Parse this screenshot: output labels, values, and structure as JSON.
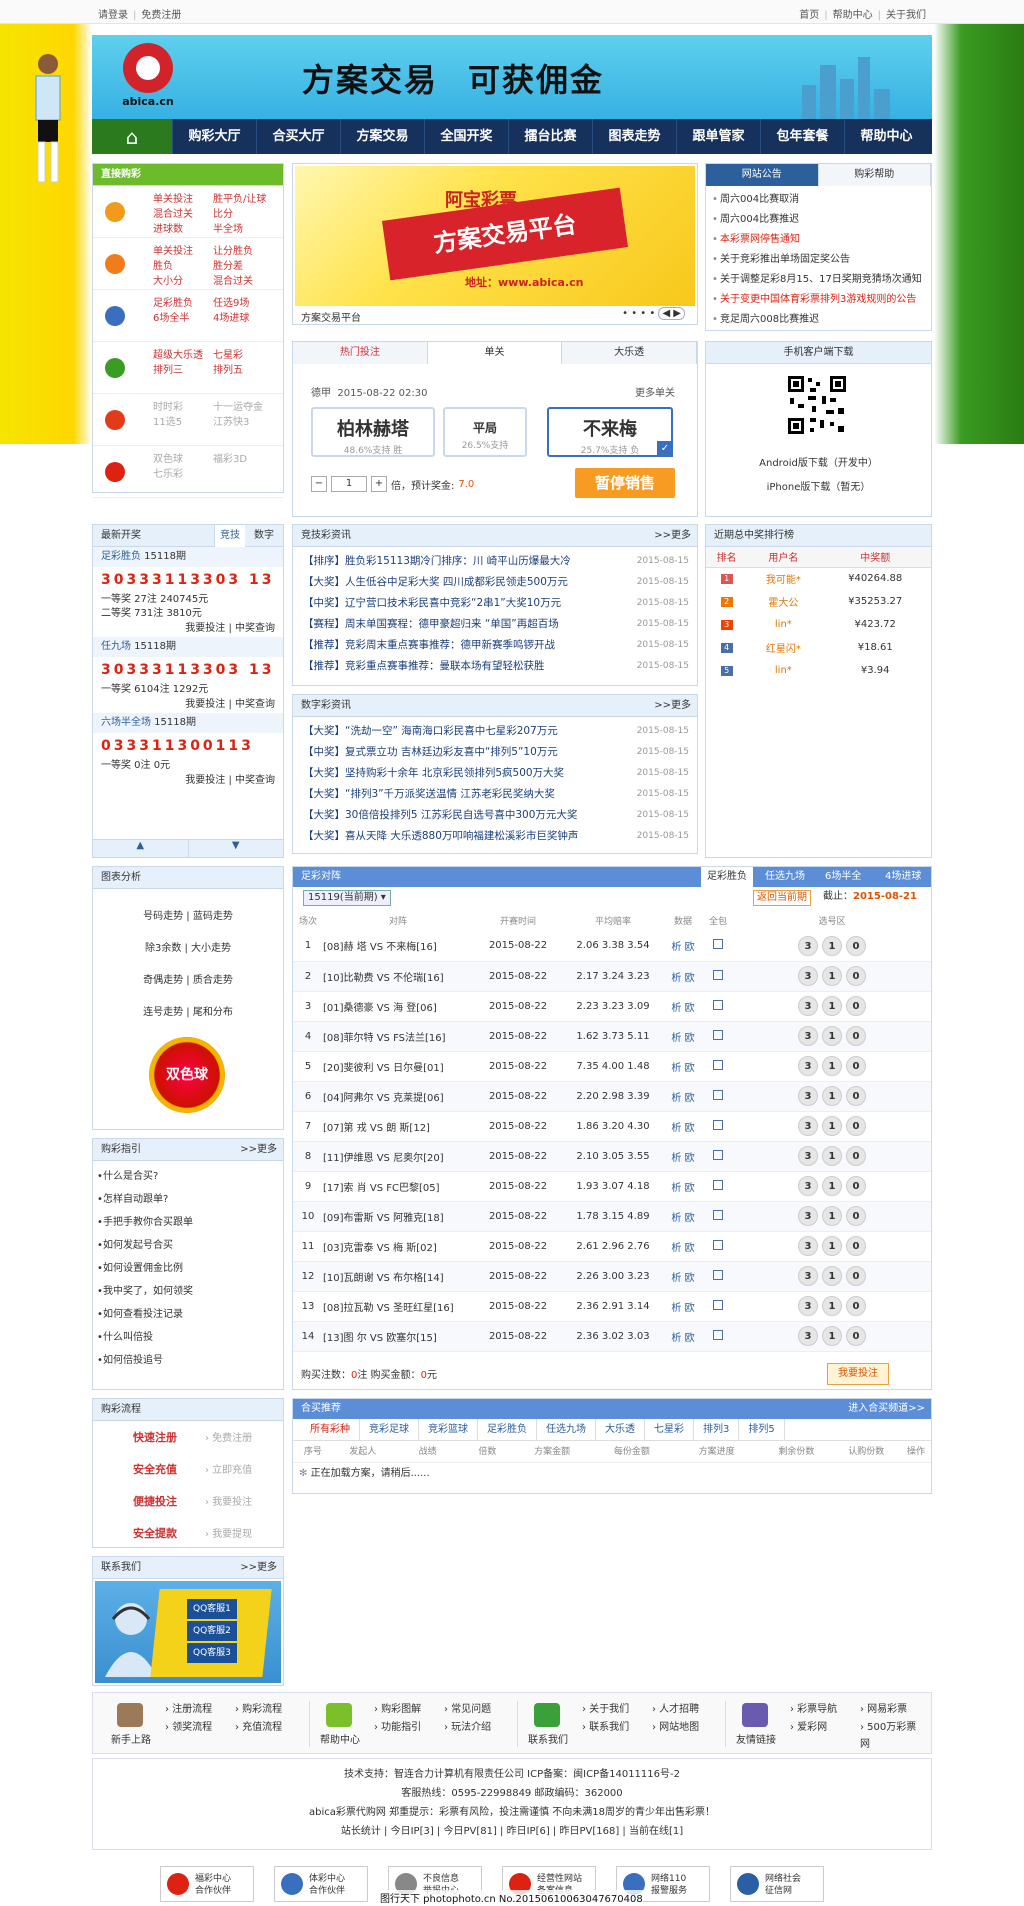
{
  "topbar": {
    "login": "请登录",
    "register": "免费注册",
    "home": "首页",
    "help": "帮助中心",
    "about": "关于我们"
  },
  "brand": {
    "site": "abica.cn",
    "slogan1": "方案交易",
    "slogan2": "可获佣金"
  },
  "nav": [
    "购彩大厅",
    "合买大厅",
    "方案交易",
    "全国开奖",
    "擂台比赛",
    "图表走势",
    "跟单管家",
    "包年套餐",
    "帮助中心"
  ],
  "lotto": {
    "title": "直接购彩",
    "rows": [
      {
        "c1": [
          "单关投注",
          "混合过关",
          "进球数"
        ],
        "c2": [
          "胜平负/让球",
          "比分",
          "半全场"
        ],
        "color": "#f29a1a"
      },
      {
        "c1": [
          "单关投注",
          "胜负",
          "大小分"
        ],
        "c2": [
          "让分胜负",
          "胜分差",
          "混合过关"
        ],
        "color": "#f07d1a"
      },
      {
        "c1": [
          "足彩胜负",
          "6场全半"
        ],
        "c2": [
          "任选9场",
          "4场进球"
        ],
        "color": "#3a6ebf"
      },
      {
        "c1": [
          "超级大乐透",
          "排列三"
        ],
        "c2": [
          "七星彩",
          "排列五"
        ],
        "color": "#3a9c22"
      },
      {
        "c1": [
          "时时彩",
          "11选5"
        ],
        "c2": [
          "十一运夺金",
          "江苏快3"
        ],
        "color": "#e23b1a",
        "grey": true
      },
      {
        "c1": [
          "双色球",
          "七乐彩"
        ],
        "c2": [
          "福彩3D"
        ],
        "color": "#d21",
        "grey": true
      }
    ]
  },
  "banner": {
    "top": "阿宝彩票",
    "main": "方案交易平台",
    "url": "地址：www.abica.cn",
    "caption": "方案交易平台"
  },
  "notice": {
    "tabs": [
      "网站公告",
      "购彩帮助"
    ],
    "items": [
      {
        "t": "周六004比赛取消",
        "red": false
      },
      {
        "t": "周六004比赛推迟",
        "red": false
      },
      {
        "t": "本彩票网停售通知",
        "red": true
      },
      {
        "t": "关于竞彩推出单场固定奖公告",
        "red": false
      },
      {
        "t": "关于调整足彩8月15、17日奖期竞猜场次通知",
        "red": false
      },
      {
        "t": "关于变更中国体育彩票排列3游戏规则的公告",
        "red": true
      },
      {
        "t": "竞足周六008比赛推迟",
        "red": false
      }
    ]
  },
  "hot": {
    "tabs": [
      "热门投注",
      "单关",
      "大乐透"
    ],
    "league": "德甲",
    "time": "2015-08-22 02:30",
    "more": "更多单关",
    "home": "柏林赫塔",
    "home_s": "48.6%支持 胜",
    "draw": "平局",
    "draw_s": "26.5%支持",
    "away": "不来梅",
    "away_s": "25.7%支持 负",
    "qty": "1",
    "mult": "倍，预计奖金:",
    "prize": "7.0",
    "stop": "暂停销售"
  },
  "app": {
    "title": "手机客户端下载",
    "android": "Android版下载（开发中）",
    "iphone": "iPhone版下载（暂无）"
  },
  "draw": {
    "title": "最新开奖",
    "tabs": [
      "竞技",
      "数字"
    ],
    "items": [
      {
        "name": "足彩胜负",
        "issue": "15118期",
        "nums": "30333113303 13",
        "lines": [
          "一等奖 27注 240745元",
          "二等奖 731注 3810元"
        ]
      },
      {
        "name": "任九场",
        "issue": "15118期",
        "nums": "30333113303 13",
        "lines": [
          "一等奖 6104注 1292元"
        ]
      },
      {
        "name": "六场半全场",
        "issue": "15118期",
        "nums": "033311300113",
        "lines": [
          "一等奖 0注 0元"
        ]
      }
    ],
    "links": "我要投注 | 中奖查询"
  },
  "sportsnews": {
    "title": "竞技彩资讯",
    "more": ">>更多",
    "items": [
      {
        "t": "【排序】胜负彩15113期冷门排序：川 崎平山历爆最大冷",
        "d": "2015-08-15"
      },
      {
        "t": "【大奖】人生低谷中足彩大奖 四川成都彩民领走500万元",
        "d": "2015-08-15"
      },
      {
        "t": "【中奖】辽宁营口技术彩民喜中竞彩“2串1”大奖10万元",
        "d": "2015-08-15"
      },
      {
        "t": "【赛程】周末单国赛程：德甲豪超归来 “单国”再超百场",
        "d": "2015-08-15"
      },
      {
        "t": "【推荐】竞彩周末重点赛事推荐：德甲新赛季鸣锣开战",
        "d": "2015-08-15"
      },
      {
        "t": "【推荐】竞彩重点赛事推荐：曼联本场有望轻松获胜",
        "d": "2015-08-15"
      }
    ]
  },
  "numnews": {
    "title": "数字彩资讯",
    "more": ">>更多",
    "items": [
      {
        "t": "【大奖】“洗劫一空” 海南海口彩民喜中七星彩207万元",
        "d": "2015-08-15"
      },
      {
        "t": "【中奖】复式票立功 吉林廷边彩友喜中“排列5”10万元",
        "d": "2015-08-15"
      },
      {
        "t": "【大奖】坚持购彩十余年 北京彩民领排列5疯500万大奖",
        "d": "2015-08-15"
      },
      {
        "t": "【大奖】“排列3”千万派奖送温情 江苏老彩民奖纳大奖",
        "d": "2015-08-15"
      },
      {
        "t": "【大奖】30倍倍投排列5 江苏彩民自选号喜中300万元大奖",
        "d": "2015-08-15"
      },
      {
        "t": "【大奖】喜从天降 大乐透880万叩响福建松溪彩市巨奖钟声",
        "d": "2015-08-15"
      }
    ]
  },
  "rank": {
    "title": "近期总中奖排行榜",
    "head": [
      "排名",
      "用户名",
      "中奖额"
    ],
    "rows": [
      {
        "r": "1",
        "u": "我可能*",
        "m": "¥40264.88",
        "c": "#d55"
      },
      {
        "r": "2",
        "u": "霍大公",
        "m": "¥35253.27",
        "c": "#e70"
      },
      {
        "r": "3",
        "u": "lin*",
        "m": "¥423.72",
        "c": "#e40"
      },
      {
        "r": "4",
        "u": "红星闪*",
        "m": "¥18.61",
        "c": "#4a6fa5"
      },
      {
        "r": "5",
        "u": "lin*",
        "m": "¥3.94",
        "c": "#4a6fa5"
      }
    ]
  },
  "chart": {
    "title": "图表分析",
    "items": [
      "号码走势 | 蓝码走势",
      "除3余数 | 大小走势",
      "奇偶走势 | 质合走势",
      "连号走势 | 尾和分布"
    ],
    "logo": "双色球"
  },
  "guide": {
    "title": "购彩指引",
    "more": ">>更多",
    "items": [
      "什么是合买?",
      "怎样自动跟单?",
      "手把手教你合买跟单",
      "如何发起号合买",
      "如何设置佣金比例",
      "我中奖了，如何领奖",
      "如何查看投注记录",
      "什么叫倍投",
      "如何倍投追号"
    ]
  },
  "flow": {
    "title": "购彩流程",
    "items": [
      {
        "a": "快速注册",
        "b": "免费注册"
      },
      {
        "a": "安全充值",
        "b": "立即充值"
      },
      {
        "a": "便捷投注",
        "b": "我要投注"
      },
      {
        "a": "安全提款",
        "b": "我要提现"
      }
    ]
  },
  "contact": {
    "title": "联系我们",
    "more": ">>更多",
    "qq": [
      "QQ客服1",
      "QQ客服2",
      "QQ客服3"
    ]
  },
  "zc": {
    "title": "足彩对阵",
    "tabs": [
      "足彩胜负",
      "任选九场",
      "6场半全",
      "4场进球"
    ],
    "period": "15119(当前期)",
    "back": "返回当前期",
    "deadline_label": "截止：",
    "deadline": "2015-08-21",
    "head": [
      "场次",
      "对阵",
      "开赛时间",
      "平均赔率",
      "数据",
      "全包",
      "选号区"
    ],
    "rows": [
      {
        "n": "1",
        "h": "[08]赫 塔",
        "a": "不来梅[16]",
        "t": "2015-08-22",
        "o": "2.06 3.38 3.54"
      },
      {
        "n": "2",
        "h": "[10]比勒费",
        "a": "不伦瑞[16]",
        "t": "2015-08-22",
        "o": "2.17 3.24 3.23"
      },
      {
        "n": "3",
        "h": "[01]桑德豪",
        "a": "海 登[06]",
        "t": "2015-08-22",
        "o": "2.23 3.23 3.09"
      },
      {
        "n": "4",
        "h": "[08]菲尔特",
        "a": "FS法兰[16]",
        "t": "2015-08-22",
        "o": "1.62 3.73 5.11"
      },
      {
        "n": "5",
        "h": "[20]斐彼利",
        "a": "日尔曼[01]",
        "t": "2015-08-22",
        "o": "7.35 4.00 1.48"
      },
      {
        "n": "6",
        "h": "[04]阿弗尔",
        "a": "克莱提[06]",
        "t": "2015-08-22",
        "o": "2.20 2.98 3.39"
      },
      {
        "n": "7",
        "h": "[07]第 戎",
        "a": "朗 斯[12]",
        "t": "2015-08-22",
        "o": "1.86 3.20 4.30"
      },
      {
        "n": "8",
        "h": "[11]伊维恩",
        "a": "尼奥尔[20]",
        "t": "2015-08-22",
        "o": "2.10 3.05 3.55"
      },
      {
        "n": "9",
        "h": "[17]索 肖",
        "a": "FC巴黎[05]",
        "t": "2015-08-22",
        "o": "1.93 3.07 4.18"
      },
      {
        "n": "10",
        "h": "[09]布雷斯",
        "a": "阿雅克[18]",
        "t": "2015-08-22",
        "o": "1.78 3.15 4.89"
      },
      {
        "n": "11",
        "h": "[03]克雷泰",
        "a": "梅 斯[02]",
        "t": "2015-08-22",
        "o": "2.61 2.96 2.76"
      },
      {
        "n": "12",
        "h": "[10]瓦朗谢",
        "a": "布尔格[14]",
        "t": "2015-08-22",
        "o": "2.26 3.00 3.23"
      },
      {
        "n": "13",
        "h": "[08]拉瓦勒",
        "a": "圣旺红星[16]",
        "t": "2015-08-22",
        "o": "2.36 2.91 3.14"
      },
      {
        "n": "14",
        "h": "[13]图 尔",
        "a": "欧塞尔[15]",
        "t": "2015-08-22",
        "o": "2.36 3.02 3.03"
      }
    ],
    "vs": "VS",
    "data": "析 欧",
    "picks": [
      "3",
      "1",
      "0"
    ],
    "buy_count_label": "购买注数：",
    "buy_count": "0",
    "buy_unit": "注 购买金额：",
    "buy_amt": "0",
    "buy_amt_unit": "元",
    "bet": "我要投注"
  },
  "hemai": {
    "title": "合买推荐",
    "enter": "进入合买频道>>",
    "tabs": [
      "所有彩种",
      "竞彩足球",
      "竞彩篮球",
      "足彩胜负",
      "任选九场",
      "大乐透",
      "七星彩",
      "排列3",
      "排列5"
    ],
    "head": [
      "序号",
      "发起人",
      "战绩",
      "倍数",
      "方案金额",
      "每份金额",
      "方案进度",
      "剩余份数",
      "认购份数",
      "操作"
    ],
    "loading": "正在加载方案，请稍后......"
  },
  "footer": {
    "cols": [
      {
        "t": "新手上路",
        "links": [
          "注册流程",
          "购彩流程",
          "领奖流程",
          "充值流程"
        ],
        "c": "#9b7a5a"
      },
      {
        "t": "帮助中心",
        "links": [
          "购彩图解",
          "常见问题",
          "功能指引",
          "玩法介绍"
        ],
        "c": "#7bbf2a"
      },
      {
        "t": "联系我们",
        "links": [
          "关于我们",
          "人才招聘",
          "联系我们",
          "网站地图"
        ],
        "c": "#3aa03a"
      },
      {
        "t": "友情链接",
        "links": [
          "彩票导航",
          "网易彩票",
          "爱彩网",
          "500万彩票网"
        ],
        "c": "#6a5ab0"
      }
    ],
    "info": [
      "技术支持：智连合力计算机有限责任公司 ICP备案：闽ICP备14011116号-2",
      "客服热线：0595-22998849 邮政编码：362000",
      "abica彩票代购网 郑重提示：彩票有风险，投注需谨慎 不向未满18周岁的青少年出售彩票！",
      "站长统计 | 今日IP[3] | 今日PV[81] | 昨日IP[6] | 昨日PV[168] | 当前在线[1]"
    ],
    "badges": [
      {
        "a": "福彩中心",
        "b": "合作伙伴",
        "c": "#d21"
      },
      {
        "a": "体彩中心",
        "b": "合作伙伴",
        "c": "#3a6ebf"
      },
      {
        "a": "不良信息",
        "b": "举报中心",
        "c": "#888"
      },
      {
        "a": "经营性网站",
        "b": "备案信息",
        "c": "#d21"
      },
      {
        "a": "网络110",
        "b": "报警服务",
        "c": "#3a6ebf"
      },
      {
        "a": "网络社会",
        "b": "征信网",
        "c": "#2a5fa5"
      }
    ],
    "watermark": "图行天下 photophoto.cn No.20150610063047670408"
  }
}
